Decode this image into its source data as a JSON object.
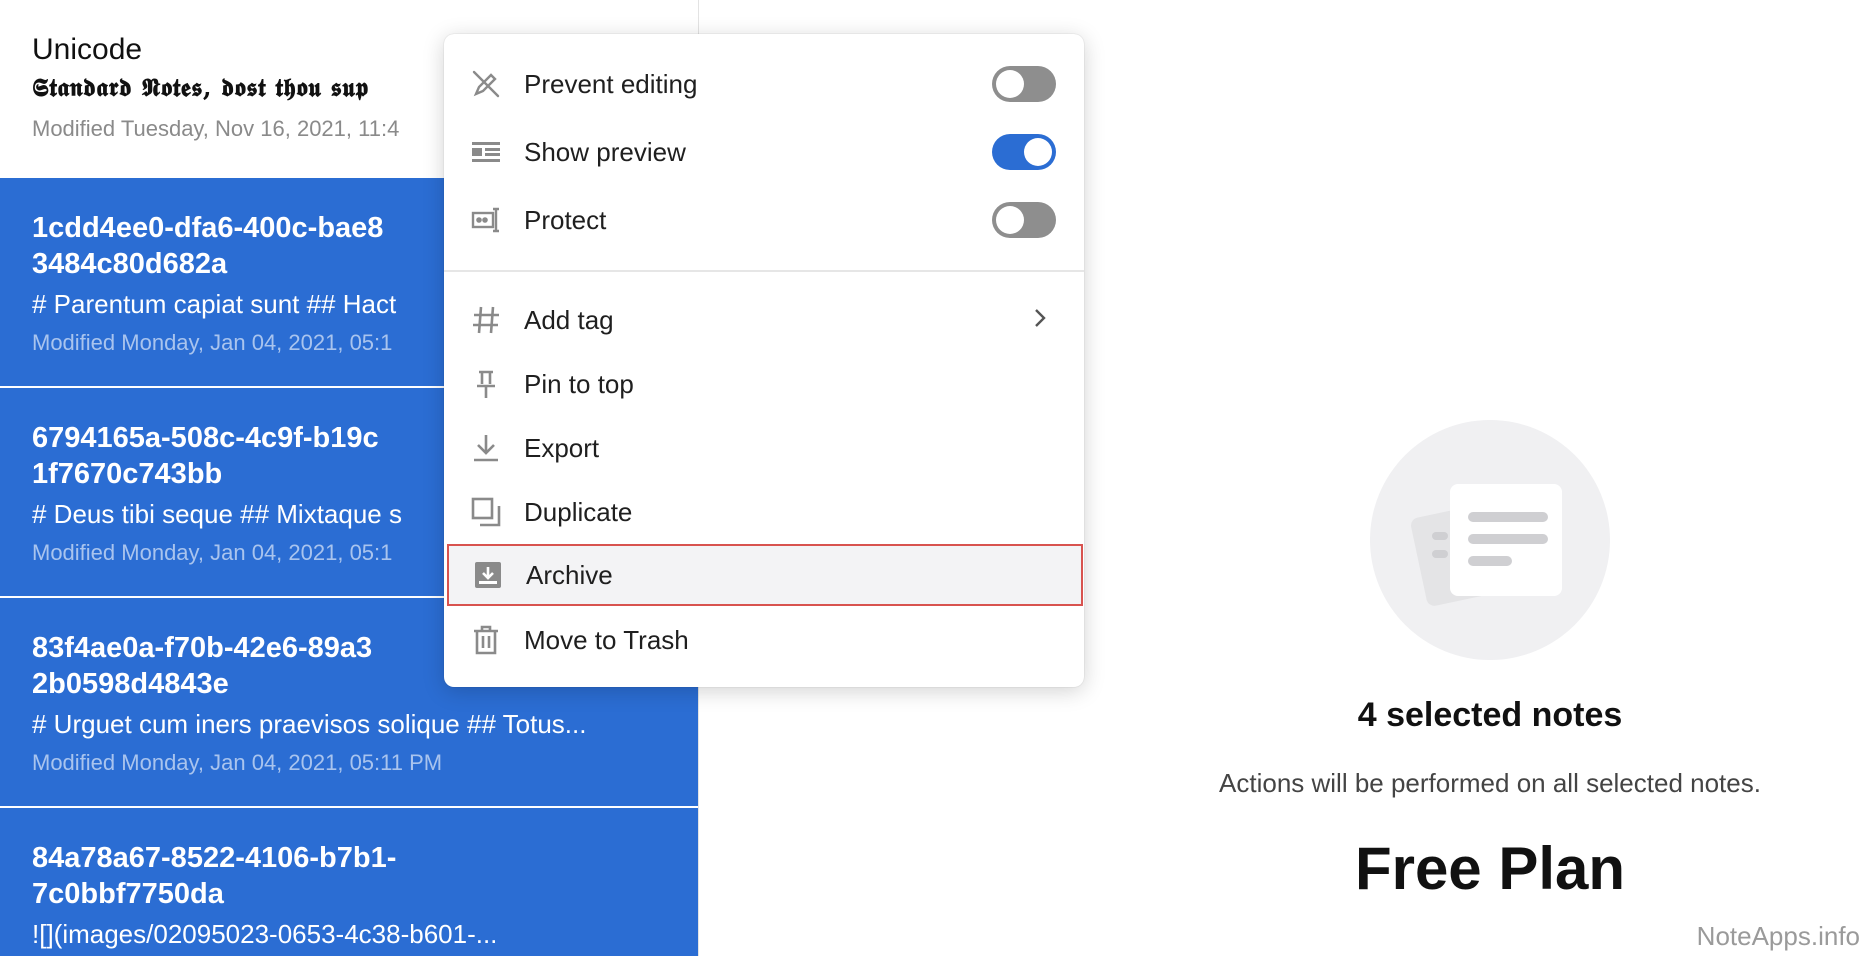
{
  "notes": [
    {
      "title": "Unicode",
      "preview": "𝕾𝖙𝖆𝖓𝖉𝖆𝖗𝖉 𝕹𝖔𝖙𝖊𝖘, 𝖉𝖔𝖘𝖙 𝖙𝖍𝖔𝖚 𝖘𝖚𝖕",
      "date": "Modified Tuesday, Nov 16, 2021, 11:4",
      "selected": false
    },
    {
      "title": "1cdd4ee0-dfa6-400c-bae8\n3484c80d682a",
      "preview": "# Parentum capiat sunt ## Hact",
      "date": "Modified Monday, Jan 04, 2021, 05:1",
      "selected": true
    },
    {
      "title": "6794165a-508c-4c9f-b19c\n1f7670c743bb",
      "preview": "# Deus tibi seque ## Mixtaque s",
      "date": "Modified Monday, Jan 04, 2021, 05:1",
      "selected": true
    },
    {
      "title": "83f4ae0a-f70b-42e6-89a3\n2b0598d4843e",
      "preview": "# Urguet cum iners praevisos solique ## Totus...",
      "date": "Modified Monday, Jan 04, 2021, 05:11 PM",
      "selected": true
    },
    {
      "title": "84a78a67-8522-4106-b7b1-\n7c0bbf7750da",
      "preview": "![](images/02095023-0653-4c38-b601-...",
      "date": "",
      "selected": true
    }
  ],
  "menu": {
    "toggles": [
      {
        "label": "Prevent editing",
        "icon": "pencil-off-icon",
        "on": false
      },
      {
        "label": "Show preview",
        "icon": "rich-text-icon",
        "on": true
      },
      {
        "label": "Protect",
        "icon": "password-icon",
        "on": false
      }
    ],
    "actions": [
      {
        "label": "Add tag",
        "icon": "hashtag-icon",
        "submenu": true
      },
      {
        "label": "Pin to top",
        "icon": "pin-icon"
      },
      {
        "label": "Export",
        "icon": "download-icon"
      },
      {
        "label": "Duplicate",
        "icon": "copy-icon"
      },
      {
        "label": "Archive",
        "icon": "archive-icon",
        "highlighted": true
      },
      {
        "label": "Move to Trash",
        "icon": "trash-icon"
      }
    ]
  },
  "selection": {
    "title": "4 selected notes",
    "subtitle": "Actions will be performed on all selected notes.",
    "plan": "Free Plan"
  },
  "watermark": "NoteApps.info",
  "colors": {
    "accent": "#2b6dd3",
    "highlight_border": "#d8534f",
    "toggle_off": "#8e8e8e"
  }
}
